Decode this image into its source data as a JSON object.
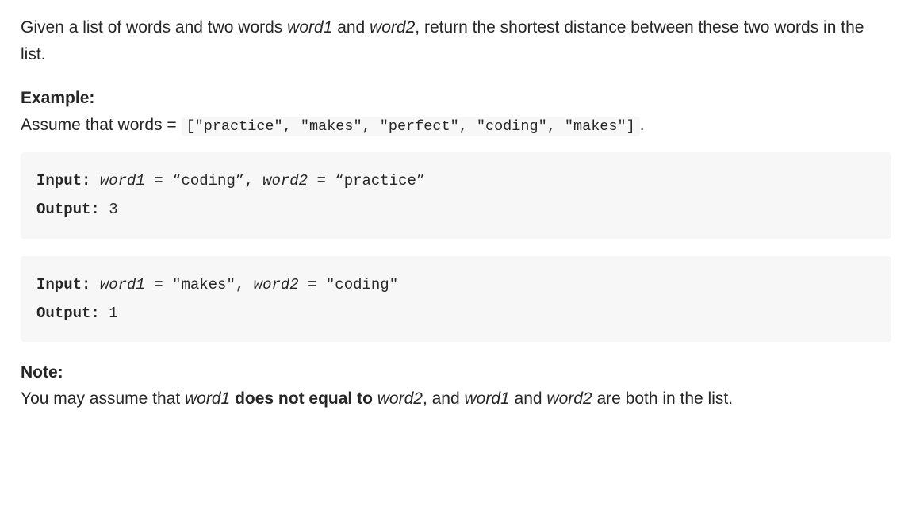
{
  "intro": {
    "prefix": "Given a list of words and two words ",
    "w1": "word1",
    "mid1": " and ",
    "w2": "word2",
    "suffix": ", return the shortest distance between these two words in the list."
  },
  "example": {
    "label": "Example:",
    "assume_prefix": "Assume that words = ",
    "words_code": "[\"practice\", \"makes\", \"perfect\", \"coding\", \"makes\"]",
    "assume_suffix": "."
  },
  "blocks": [
    {
      "input_label": "Input:",
      "w1_label": "word1",
      "w1_assign": " = “coding”, ",
      "w2_label": "word2",
      "w2_assign": " = “practice”",
      "output_label": "Output:",
      "output_value": " 3"
    },
    {
      "input_label": "Input:",
      "w1_label": "word1",
      "w1_assign": " = \"makes\", ",
      "w2_label": "word2",
      "w2_assign": " = \"coding\"",
      "output_label": "Output:",
      "output_value": " 1"
    }
  ],
  "note": {
    "label": "Note:",
    "t1": "You may assume that ",
    "w1": "word1",
    "t2": " ",
    "strong": "does not equal to",
    "t3": " ",
    "w2": "word2",
    "t4": ", and ",
    "w1b": "word1",
    "t5": " and ",
    "w2b": "word2",
    "t6": " are both in the list."
  }
}
